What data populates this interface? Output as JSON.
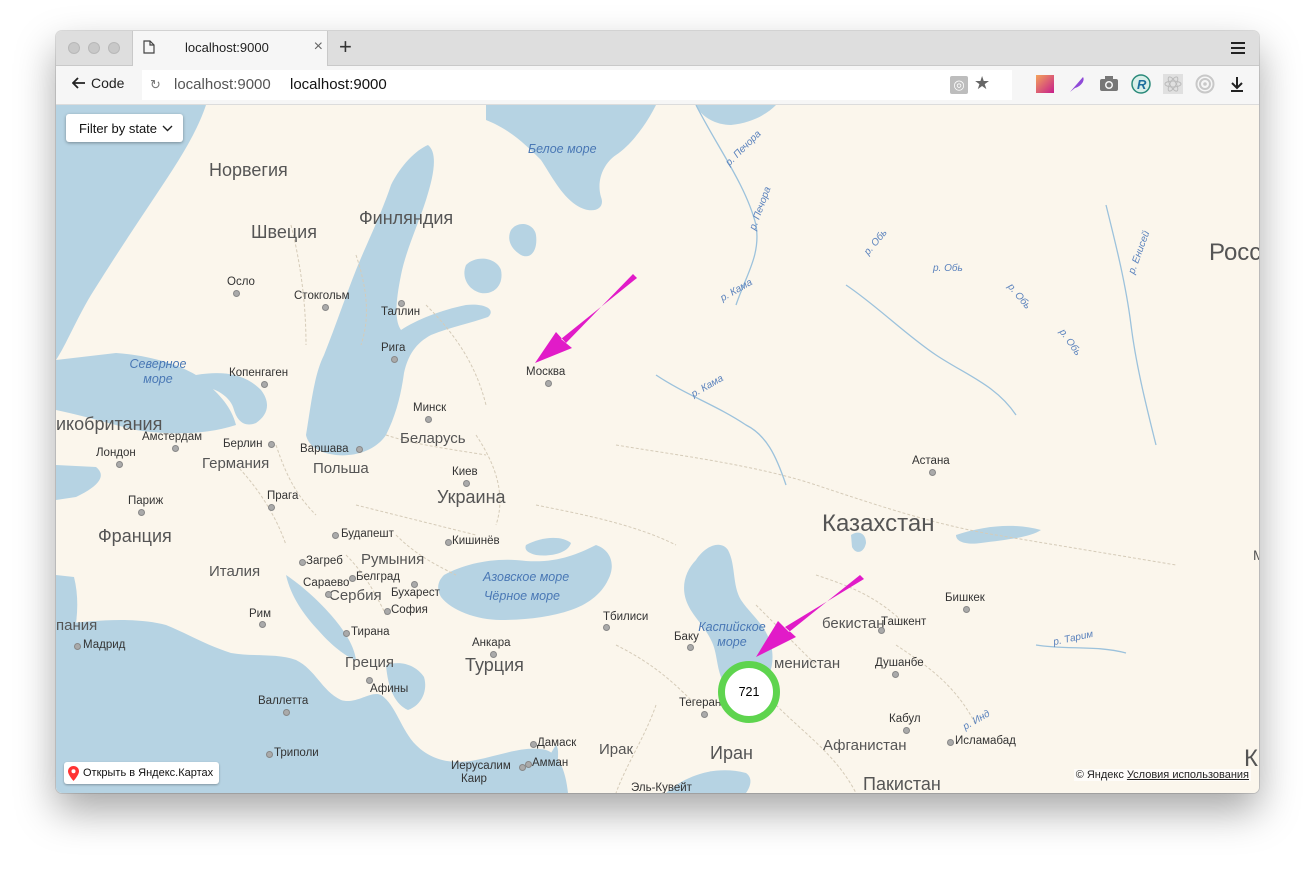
{
  "browser": {
    "tab_title": "localhost:9000",
    "back_label": "Code",
    "url_display": "localhost:9000",
    "url_text": "localhost:9000",
    "extensions": [
      "color-palette-icon",
      "feather-pen-icon",
      "camera-icon",
      "r-logo-icon",
      "react-devtools-icon",
      "target-icon",
      "download-icon"
    ]
  },
  "controls": {
    "filter_label": "Filter by state"
  },
  "cluster": {
    "count": "721",
    "ring_color": "#5ed44e"
  },
  "annotation": {
    "arrow_color": "#e11bc8"
  },
  "map": {
    "countries": {
      "norway": "Норвегия",
      "sweden": "Швеция",
      "finland": "Финляндия",
      "uk": "икобритания",
      "germany": "Германия",
      "poland": "Польша",
      "belarus": "Беларусь",
      "ukraine": "Украина",
      "france": "Франция",
      "italy": "Италия",
      "romania": "Румыния",
      "serbia": "Сербия",
      "spain": "пания",
      "greece": "Греция",
      "turkey": "Турция",
      "kazakhstan": "Казахстан",
      "uzbekistan": "бекистан",
      "turkmenistan": "менистан",
      "iran": "Иран",
      "iraq": "Ирак",
      "afghanistan": "Афганистан",
      "pakistan": "Пакистан",
      "russia": "Росс"
    },
    "cities": {
      "oslo": "Осло",
      "stockholm": "Стокгольм",
      "tallinn": "Таллин",
      "riga": "Рига",
      "copenhagen": "Копенгаген",
      "moscow": "Москва",
      "minsk": "Минск",
      "amsterdam": "Амстердам",
      "berlin": "Берлин",
      "warsaw": "Варшава",
      "london": "Лондон",
      "kiev": "Киев",
      "paris": "Париж",
      "prague": "Прага",
      "budapest": "Будапешт",
      "chisinau": "Кишинёв",
      "zagreb": "Загреб",
      "belgrade": "Белград",
      "sarajevo": "Сараево",
      "bucharest": "Бухарест",
      "sofia": "София",
      "rome": "Рим",
      "madrid": "Мадрид",
      "tirana": "Тирана",
      "tbilisi": "Тбилиси",
      "baku": "Баку",
      "ankara": "Анкара",
      "athens": "Афины",
      "valletta": "Валлетта",
      "tehran": "Тегеран",
      "tripoli": "Триполи",
      "damascus": "Дамаск",
      "jerusalem": "Иерусалим",
      "amman": "Амман",
      "cairo": "Каир",
      "kuwait": "Эль-Кувейт",
      "astana": "Астана",
      "bishkek": "Бишкек",
      "tashkent": "Ташкент",
      "dushanbe": "Душанбе",
      "kabul": "Кабул",
      "islamabad": "Исламабад"
    },
    "water": {
      "white_sea": "Белое море",
      "north_sea": "Северное море",
      "azov_sea": "Азовское море",
      "black_sea": "Чёрное море",
      "caspian_sea": "Каспийское море"
    },
    "rivers": {
      "pechora": "р. Печора",
      "kama": "р. Кама",
      "ob": "р. Обь",
      "yenisei": "р. Енисей",
      "tarim": "р. Тарим",
      "indus": "р. Инд"
    },
    "edge_letters": {
      "m": "М",
      "k": "К"
    },
    "open_in_maps": "Открыть в Яндекс.Картах",
    "copyright": "© Яндекс",
    "terms": "Условия использования"
  }
}
